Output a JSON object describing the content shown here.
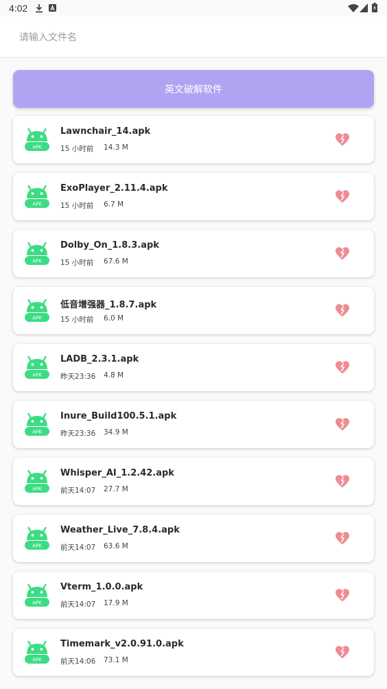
{
  "status_bar": {
    "time": "4:02",
    "left_icons": [
      "download-icon",
      "a-notification-icon"
    ],
    "right_icons": [
      "wifi-icon",
      "signal-icon",
      "battery-icon"
    ]
  },
  "search": {
    "placeholder": "请输入文件名",
    "value": ""
  },
  "main_button": {
    "label": "英文破解软件",
    "color": "#b0a4f2"
  },
  "icons": {
    "file": "android-apk-icon",
    "action": "heart-icon",
    "file_icon_text": "APK"
  },
  "colors": {
    "apk_green": "#3ddc84",
    "heart": "#ef8b92"
  },
  "files": [
    {
      "name": "Lawnchair_14.apk",
      "time": "15 小时前",
      "size": "14.3 M"
    },
    {
      "name": "ExoPlayer_2.11.4.apk",
      "time": "15 小时前",
      "size": "6.7 M"
    },
    {
      "name": "Dolby_On_1.8.3.apk",
      "time": "15 小时前",
      "size": "67.6 M"
    },
    {
      "name": "低音增强器_1.8.7.apk",
      "time": "15 小时前",
      "size": "6.0 M"
    },
    {
      "name": "LADB_2.3.1.apk",
      "time": "昨天23:36",
      "size": "4.8 M"
    },
    {
      "name": "Inure_Build100.5.1.apk",
      "time": "昨天23:36",
      "size": "34.9 M"
    },
    {
      "name": "Whisper_AI_1.2.42.apk",
      "time": "前天14:07",
      "size": "27.7 M"
    },
    {
      "name": "Weather_Live_7.8.4.apk",
      "time": "前天14:07",
      "size": "63.6 M"
    },
    {
      "name": "Vterm_1.0.0.apk",
      "time": "前天14:07",
      "size": "17.9 M"
    },
    {
      "name": "Timemark_v2.0.91.0.apk",
      "time": "前天14:06",
      "size": "73.1 M"
    }
  ]
}
